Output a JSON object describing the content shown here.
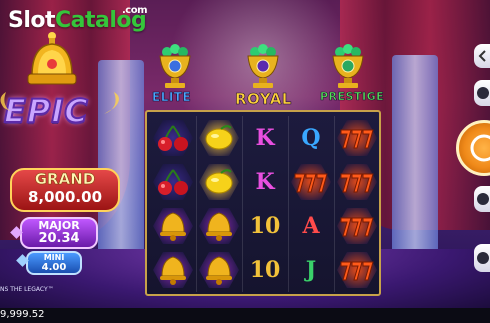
{
  "watermark": {
    "brand_a": "Slot",
    "brand_b": "Catalog",
    "suffix": ".com"
  },
  "game": {
    "feature_banner": "EPIC",
    "title_fragment": "NS THE LEGACY™"
  },
  "jackpots": {
    "grand": {
      "label": "GRAND",
      "value": "8,000.00"
    },
    "major": {
      "label": "MAJOR",
      "value": "20.34"
    },
    "mini": {
      "label": "MINI",
      "value": "4.00"
    }
  },
  "tiers": [
    {
      "label": "ELITE",
      "color": "#4aa8ff",
      "gem_color": "#2ecc71"
    },
    {
      "label": "ROYAL",
      "color": "#ffd23a",
      "gem_color": "#2ecc71"
    },
    {
      "label": "PRESTIGE",
      "color": "#57e05a",
      "gem_color": "#2ecc71"
    }
  ],
  "reels": [
    [
      "cherry",
      "cherry",
      "bell",
      "bell"
    ],
    [
      "lemon",
      "lemon",
      "bell",
      "bell"
    ],
    [
      "K",
      "K",
      "10",
      "10"
    ],
    [
      "Q",
      "seven",
      "A",
      "J"
    ],
    [
      "seven",
      "seven",
      "seven",
      "seven"
    ]
  ],
  "symbol_colors": {
    "K": "#e94fe0",
    "Q": "#3aa8ff",
    "10": "#f2c23a",
    "A": "#ff4b4b",
    "J": "#3ad16a"
  },
  "footer": {
    "balance": "9,999.52"
  },
  "colors": {
    "grand": "#d92f2f",
    "major": "#a040e8",
    "mini": "#2c6ee0",
    "spin": "#f08a1a"
  }
}
